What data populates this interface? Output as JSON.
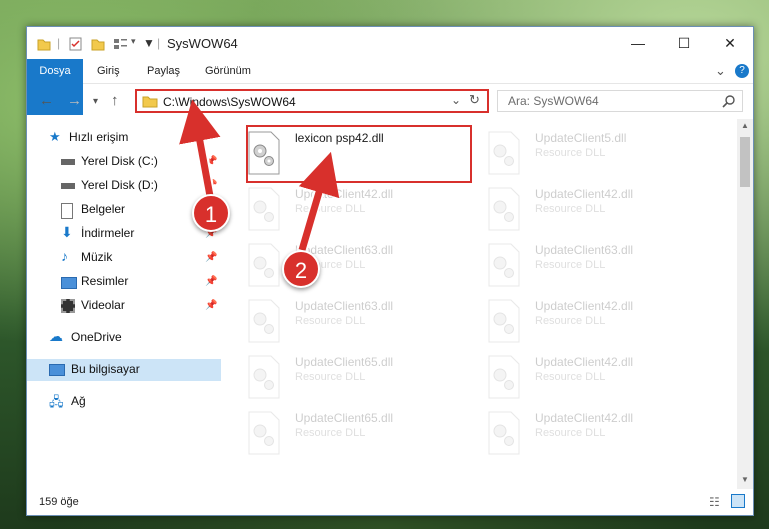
{
  "window": {
    "title": "SysWOW64",
    "controls": {
      "minimize": "—",
      "maximize": "☐",
      "close": "✕"
    }
  },
  "ribbon": {
    "tabs": [
      {
        "label": "Dosya",
        "active": true
      },
      {
        "label": "Giriş"
      },
      {
        "label": "Paylaş"
      },
      {
        "label": "Görünüm"
      }
    ],
    "expand": "⌄",
    "help": "?"
  },
  "address": {
    "path": "C:\\Windows\\SysWOW64",
    "search_placeholder": "Ara: SysWOW64"
  },
  "nav": {
    "items": [
      {
        "label": "Hızlı erişim",
        "icon": "star-icon"
      },
      {
        "label": "Yerel Disk (C:)",
        "icon": "drive-icon",
        "pinned": true
      },
      {
        "label": "Yerel Disk (D:)",
        "icon": "drive-icon",
        "pinned": true
      },
      {
        "label": "Belgeler",
        "icon": "documents-icon",
        "pinned": true
      },
      {
        "label": "İndirmeler",
        "icon": "download-icon",
        "pinned": true
      },
      {
        "label": "Müzik",
        "icon": "music-icon",
        "pinned": true
      },
      {
        "label": "Resimler",
        "icon": "pictures-icon",
        "pinned": true
      },
      {
        "label": "Videolar",
        "icon": "videos-icon",
        "pinned": true
      },
      {
        "label": "OneDrive",
        "icon": "cloud-icon"
      },
      {
        "label": "Bu bilgisayar",
        "icon": "computer-icon",
        "selected": true
      },
      {
        "label": "Ağ",
        "icon": "network-icon"
      }
    ]
  },
  "files": [
    {
      "name": "lexicon psp42.dll",
      "type": "",
      "highlighted": true
    },
    {
      "name": "UpdateClient5.dll",
      "type": "Resource DLL"
    },
    {
      "name": "UpdateClient42.dll",
      "type": "Resource DLL"
    },
    {
      "name": "UpdateClient42.dll",
      "type": "Resource DLL"
    },
    {
      "name": "UpdateClient63.dll",
      "type": "Resource DLL"
    },
    {
      "name": "UpdateClient63.dll",
      "type": "Resource DLL"
    },
    {
      "name": "UpdateClient63.dll",
      "type": "Resource DLL"
    },
    {
      "name": "UpdateClient42.dll",
      "type": "Resource DLL"
    },
    {
      "name": "UpdateClient65.dll",
      "type": "Resource DLL"
    },
    {
      "name": "UpdateClient42.dll",
      "type": "Resource DLL"
    },
    {
      "name": "UpdateClient65.dll",
      "type": "Resource DLL"
    },
    {
      "name": "UpdateClient42.dll",
      "type": "Resource DLL"
    }
  ],
  "status": {
    "count": "159 öğe"
  },
  "callouts": [
    "1",
    "2"
  ],
  "colors": {
    "accent": "#1979ca",
    "highlight": "#d8302c",
    "selected": "#cce4f7"
  }
}
